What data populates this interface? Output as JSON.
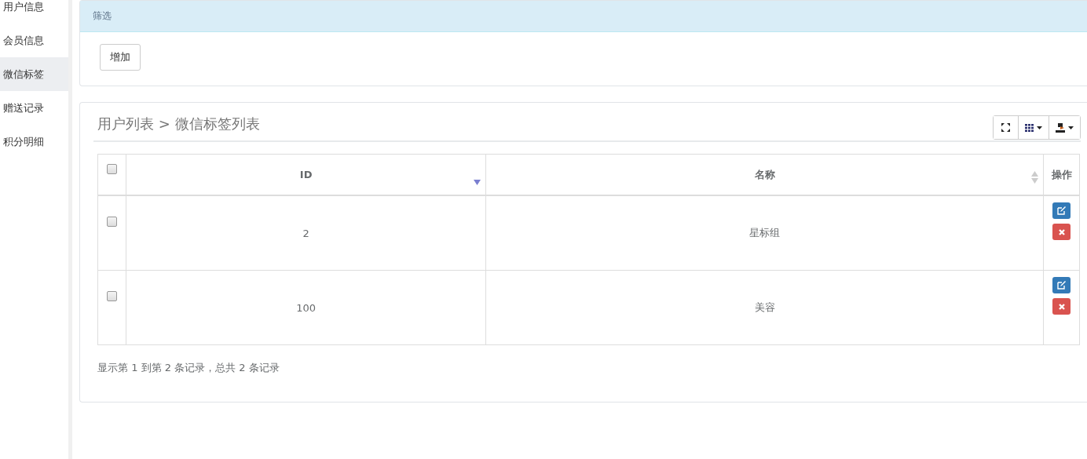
{
  "sidebar": {
    "items": [
      {
        "label": "用户信息",
        "selected": false
      },
      {
        "label": "会员信息",
        "selected": false
      },
      {
        "label": "微信标签",
        "selected": true
      },
      {
        "label": "赠送记录",
        "selected": false
      },
      {
        "label": "积分明细",
        "selected": false
      }
    ]
  },
  "filter_panel": {
    "title": "筛选",
    "buttons": [
      "增加"
    ]
  },
  "list_panel": {
    "title": "用户列表 > 微信标签列表",
    "table": {
      "select_all": {
        "checked": false
      },
      "columns": [
        {
          "label": "ID",
          "sortable": true,
          "sorted": true
        },
        {
          "label": "名称",
          "sortable": true,
          "sorted": false
        },
        {
          "label": "操作",
          "sortable": false
        }
      ],
      "rows": [
        {
          "checked": false,
          "id": "2",
          "name": "星标组"
        },
        {
          "checked": false,
          "id": "100",
          "name": "美容"
        }
      ]
    },
    "pagination": "显示第 1 到第 2 条记录，总共 2 条记录"
  }
}
